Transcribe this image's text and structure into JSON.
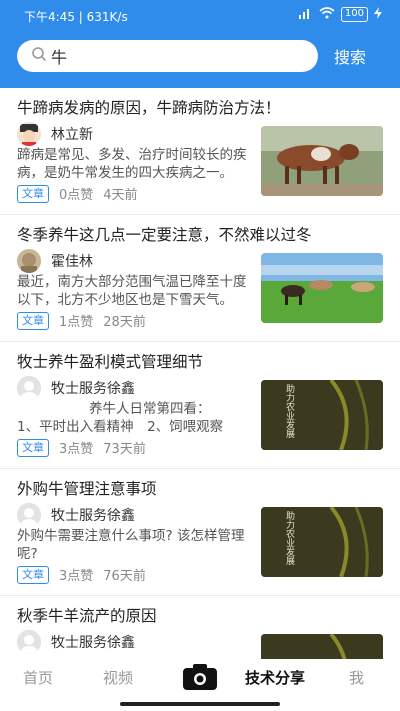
{
  "status_bar": {
    "time": "下午4:45",
    "speed": "631K/s",
    "battery": "100"
  },
  "search": {
    "value": "牛",
    "button_label": "搜索"
  },
  "articles": [
    {
      "title": "牛蹄病发病的原因，牛蹄病防治方法！",
      "author": "林立新",
      "summary": "蹄病是常见、多发、治疗时间较长的疾病，是奶牛常发生的四大疾病之一。",
      "tag": "文章",
      "likes": "0点赞",
      "time": "4天前"
    },
    {
      "title": "冬季养牛这几点一定要注意，不然难以过冬",
      "author": "霍佳林",
      "summary": "最近，南方大部分范围气温已降至十度以下，北方不少地区也是下雪天气。",
      "tag": "文章",
      "likes": "1点赞",
      "time": "28天前"
    },
    {
      "title": "牧士养牛盈利模式管理细节",
      "author": "牧士服务徐鑫",
      "summary_line1": "养牛人日常第四看：",
      "summary_line2": "1、平时出入看精神　2、饲喂观察",
      "tag": "文章",
      "likes": "3点赞",
      "time": "73天前",
      "thumb_text": "助力农业发展"
    },
    {
      "title": "外购牛管理注意事项",
      "author": "牧士服务徐鑫",
      "summary": "外购牛需要注意什么事项? 该怎样管理呢?",
      "tag": "文章",
      "likes": "3点赞",
      "time": "76天前",
      "thumb_text": "助力农业发展"
    },
    {
      "title": "秋季牛羊流产的原因",
      "author": "牧士服务徐鑫"
    }
  ],
  "nav": {
    "home": "首页",
    "video": "视频",
    "share": "技术分享",
    "me": "我"
  },
  "colors": {
    "header": "#2f8cea",
    "tag": "#2f8cea"
  }
}
